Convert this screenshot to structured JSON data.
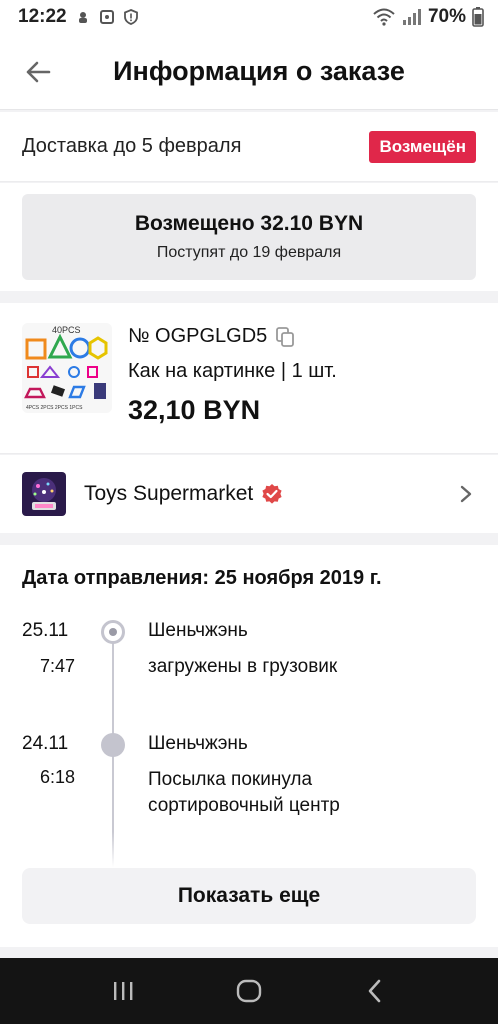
{
  "status_bar": {
    "time": "12:22",
    "battery": "70%"
  },
  "header": {
    "title": "Информация о заказе"
  },
  "delivery": {
    "text": "Доставка до 5 февраля",
    "badge": "Возмещён",
    "badge_color": "#e0274a"
  },
  "refund": {
    "amount": "Возмещено 32.10 BYN",
    "note": "Поступят до 19 февраля"
  },
  "product": {
    "image_label": "40PCS",
    "order_number": "№ OGPGLGD5",
    "variant": "Как на картинке | 1 шт.",
    "price": "32,10 BYN"
  },
  "store": {
    "name": "Toys Supermarket"
  },
  "tracking": {
    "ship_date": "Дата отправления: 25 ноября 2019 г.",
    "events": [
      {
        "date": "25.11",
        "time": "7:47",
        "city": "Шеньчжэнь",
        "description": "загружены в грузовик"
      },
      {
        "date": "24.11",
        "time": "6:18",
        "city": "Шеньчжэнь",
        "description": "Посылка покинула сортировочный центр"
      }
    ],
    "show_more": "Показать еще"
  }
}
